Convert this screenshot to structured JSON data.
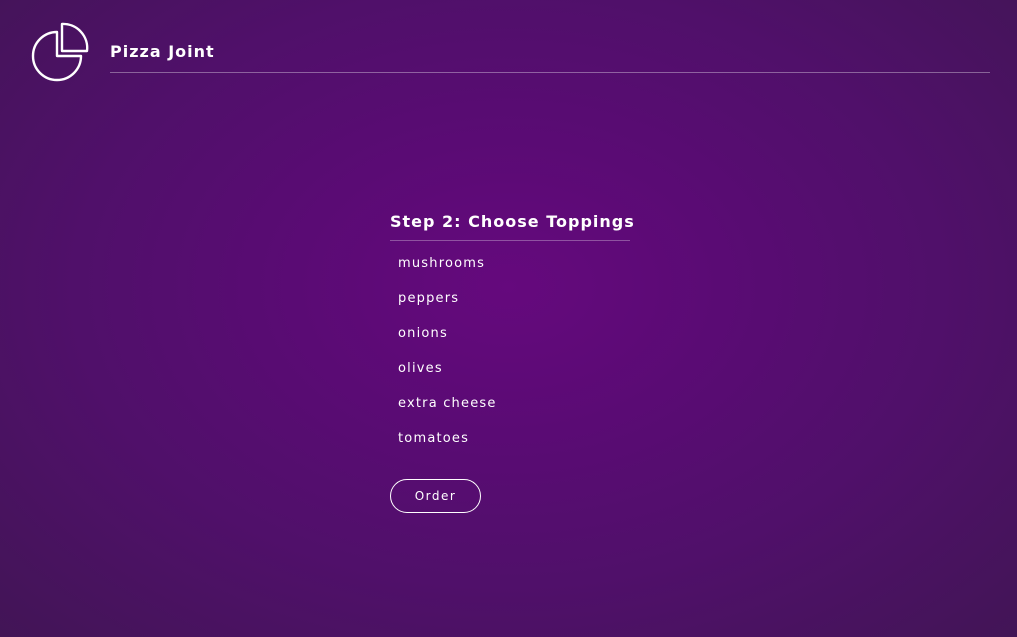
{
  "header": {
    "logo_icon": "pizza-slice-icon",
    "brand": "Pizza Joint"
  },
  "main": {
    "step_title": "Step 2: Choose Toppings",
    "toppings": [
      "mushrooms",
      "peppers",
      "onions",
      "olives",
      "extra cheese",
      "tomatoes"
    ],
    "order_label": "Order"
  },
  "colors": {
    "background_center": "#65097d",
    "background_edge": "#421556",
    "text": "#ffffff"
  }
}
